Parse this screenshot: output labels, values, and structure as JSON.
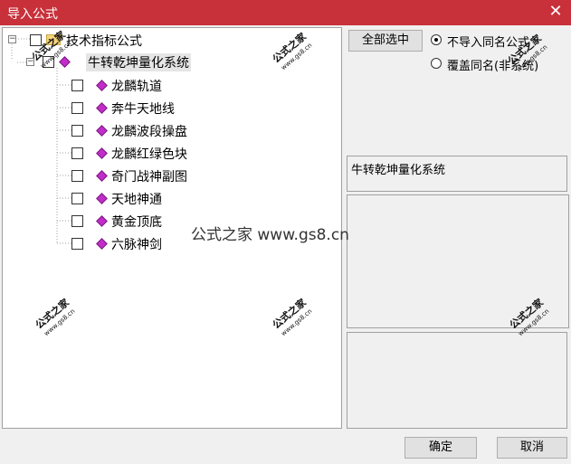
{
  "window": {
    "title": "导入公式",
    "close_glyph": "✕"
  },
  "tree": {
    "root": {
      "label": "技术指标公式",
      "expander": "−"
    },
    "sub": {
      "label": "牛转乾坤量化系统",
      "expander": "−"
    },
    "leaves": [
      "龙麟轨道",
      "奔牛天地线",
      "龙麟波段操盘",
      "龙麟红绿色块",
      "奇门战神副图",
      "天地神通",
      "黄金顶底",
      "六脉神剑"
    ]
  },
  "options": {
    "select_all_label": "全部选中",
    "radio_skip_label": "不导入同名公式",
    "radio_overwrite_label": "覆盖同名(非系统)",
    "selected_radio": "skip"
  },
  "info": {
    "selected_name": "牛转乾坤量化系统"
  },
  "footer": {
    "ok_label": "确定",
    "cancel_label": "取消"
  },
  "watermark": {
    "brand": "公式之家",
    "url": "www.gs8.cn",
    "center_text": "公式之家 www.gs8.cn"
  }
}
